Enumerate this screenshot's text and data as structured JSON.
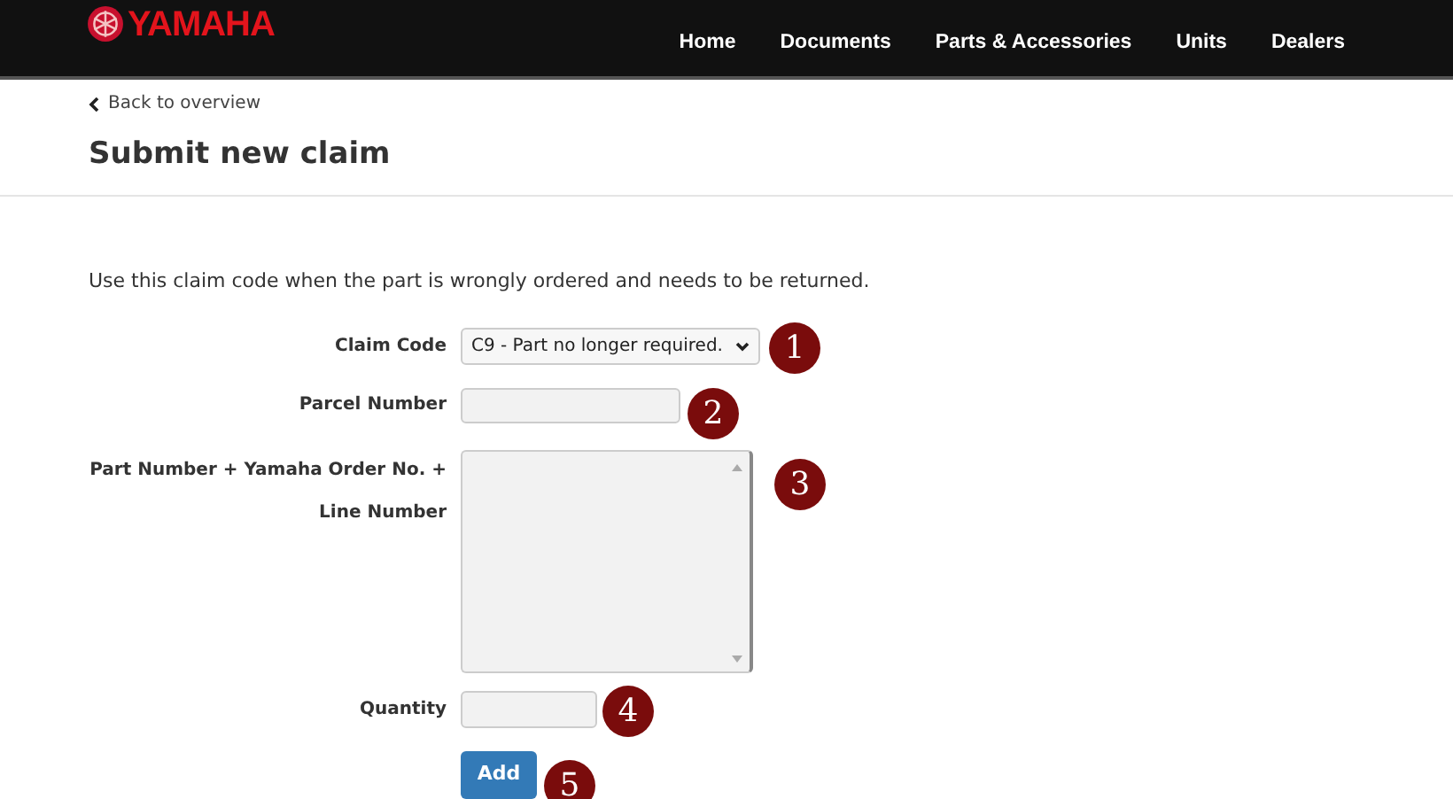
{
  "header": {
    "logo": "YAMAHA",
    "nav": [
      {
        "label": "Home"
      },
      {
        "label": "Documents"
      },
      {
        "label": "Parts & Accessories"
      },
      {
        "label": "Units"
      },
      {
        "label": "Dealers"
      }
    ]
  },
  "back_link": "Back to overview",
  "title": "Submit new claim",
  "description": "Use this claim code when the part is wrongly ordered and needs to be returned.",
  "form": [
    {
      "kind": "select",
      "label": "Claim Code",
      "value": "C9 - Part no longer required.",
      "marker": "1"
    },
    {
      "kind": "input",
      "label": "Parcel Number",
      "marker": "2"
    },
    {
      "kind": "textarea",
      "label": "Part Number + Yamaha Order No. + Line Number",
      "marker": "3"
    },
    {
      "kind": "small-input",
      "label": "Quantity",
      "marker": "4"
    },
    {
      "kind": "button",
      "label": "Add",
      "marker": "5"
    }
  ]
}
